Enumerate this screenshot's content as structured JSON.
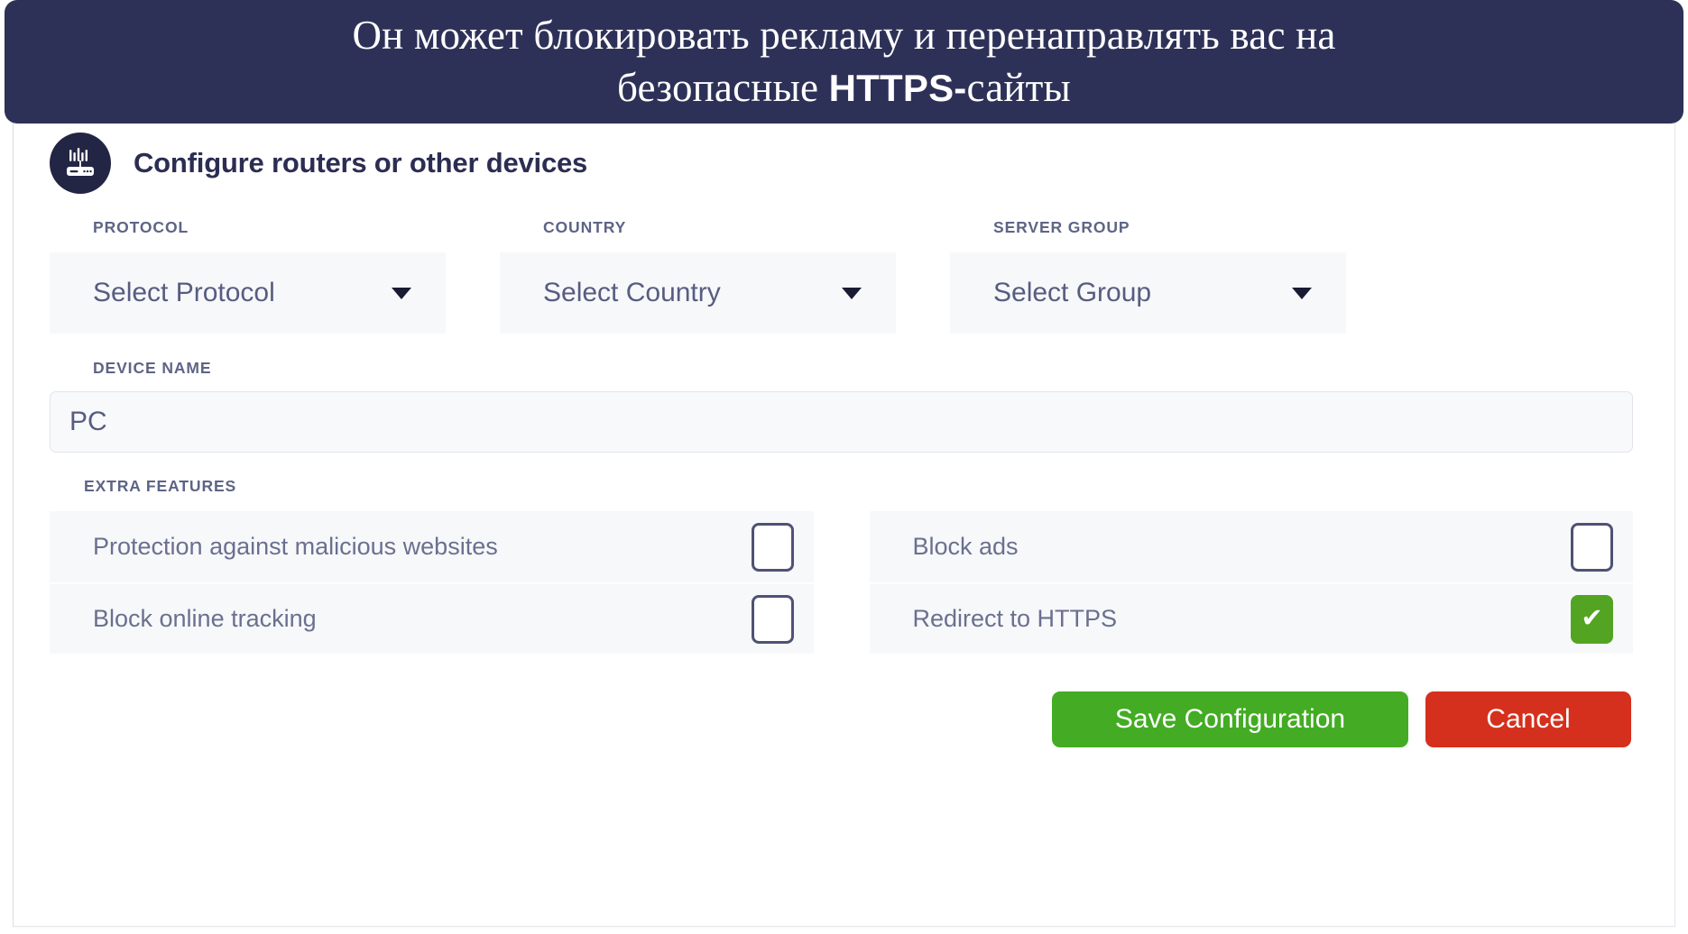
{
  "banner": {
    "text_line1": "Он может блокировать рекламу и перенаправлять вас на",
    "text_line2_prefix": "безопасные ",
    "text_line2_highlight": "HTTPS-",
    "text_line2_suffix": "сайты",
    "background_color": "#2e3157",
    "text_color": "#ffffff"
  },
  "header": {
    "icon": "router-icon",
    "title": "Configure routers or other devices"
  },
  "selects": [
    {
      "label": "PROTOCOL",
      "value": "Select Protocol",
      "caret": "chevron-down-icon"
    },
    {
      "label": "COUNTRY",
      "value": "Select Country",
      "caret": "chevron-down-icon"
    },
    {
      "label": "SERVER GROUP",
      "value": "Select Group",
      "caret": "chevron-down-icon"
    }
  ],
  "device": {
    "label": "DEVICE NAME",
    "value": "PC"
  },
  "extra_features": {
    "label": "EXTRA FEATURES",
    "left_column": [
      {
        "label": "Protection against malicious websites",
        "checked": false
      },
      {
        "label": "Block online tracking",
        "checked": false
      }
    ],
    "right_column": [
      {
        "label": "Block ads",
        "checked": false
      },
      {
        "label": "Redirect to HTTPS",
        "checked": true,
        "check_glyph": "✔"
      }
    ]
  },
  "buttons": {
    "save_label": "Save Configuration",
    "cancel_label": "Cancel",
    "save_color": "#43ac24",
    "cancel_color": "#d5301d"
  }
}
